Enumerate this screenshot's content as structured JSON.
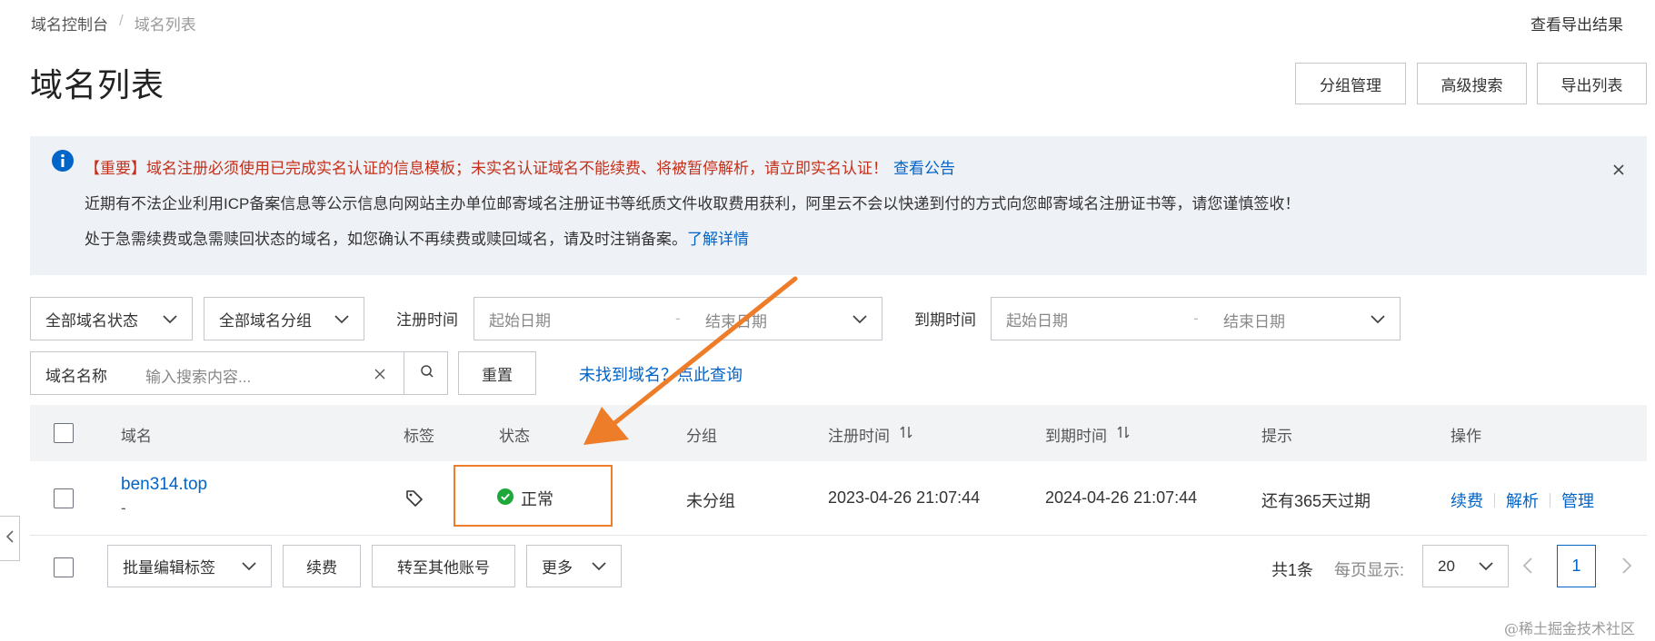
{
  "breadcrumb": {
    "root": "域名控制台",
    "sep": "/",
    "current": "域名列表"
  },
  "export_result_link": "查看导出结果",
  "page_title": "域名列表",
  "header_buttons": [
    "分组管理",
    "高级搜索",
    "导出列表"
  ],
  "notice": {
    "tag": "【重要】",
    "line1": "域名注册必须使用已完成实名认证的信息模板；未实名认证域名不能续费、将被暂停解析，请立即实名认证！",
    "line1_link": "查看公告",
    "line2": "近期有不法企业利用ICP备案信息等公示信息向网站主办单位邮寄域名注册证书等纸质文件收取费用获利，阿里云不会以快递到付的方式向您邮寄域名注册证书等，请您谨慎签收！",
    "line3": "处于急需续费或急需赎回状态的域名，如您确认不再续费或赎回域名，请及时注销备案。",
    "line3_link": "了解详情"
  },
  "filters": {
    "status_select": "全部域名状态",
    "group_select": "全部域名分组",
    "reg_time_label": "注册时间",
    "reg_start_placeholder": "起始日期",
    "reg_end_placeholder": "结束日期",
    "date_sep": "-",
    "exp_time_label": "到期时间",
    "exp_start_placeholder": "起始日期",
    "exp_end_placeholder": "结束日期",
    "search_prefix": "域名名称",
    "search_placeholder": "输入搜索内容...",
    "reset_label": "重置",
    "not_found_link": "未找到域名？点此查询"
  },
  "table": {
    "headers": {
      "domain": "域名",
      "tag": "标签",
      "status": "状态",
      "group": "分组",
      "reg_time": "注册时间",
      "exp_time": "到期时间",
      "hint": "提示",
      "actions": "操作"
    },
    "rows": [
      {
        "domain": "ben314.top",
        "subtext": "-",
        "status": "正常",
        "group": "未分组",
        "reg_time": "2023-04-26 21:07:44",
        "exp_time": "2024-04-26 21:07:44",
        "hint": "还有365天过期",
        "actions": [
          "续费",
          "解析",
          "管理"
        ]
      }
    ]
  },
  "footer": {
    "batch_tag_select": "批量编辑标签",
    "renew_button": "续费",
    "transfer_button": "转至其他账号",
    "more_select": "更多",
    "total_text": "共1条",
    "page_size_label": "每页显示:",
    "page_size_value": "20",
    "current_page": "1"
  },
  "watermark": "@稀土掘金技术社区",
  "colors": {
    "link": "#0064c8",
    "notice_bg": "#eef1f6",
    "notice_red": "#c5301a",
    "status_ok": "#1ea83a",
    "highlight_box": "#ee7d2a",
    "table_header_bg": "#f2f3f5"
  }
}
